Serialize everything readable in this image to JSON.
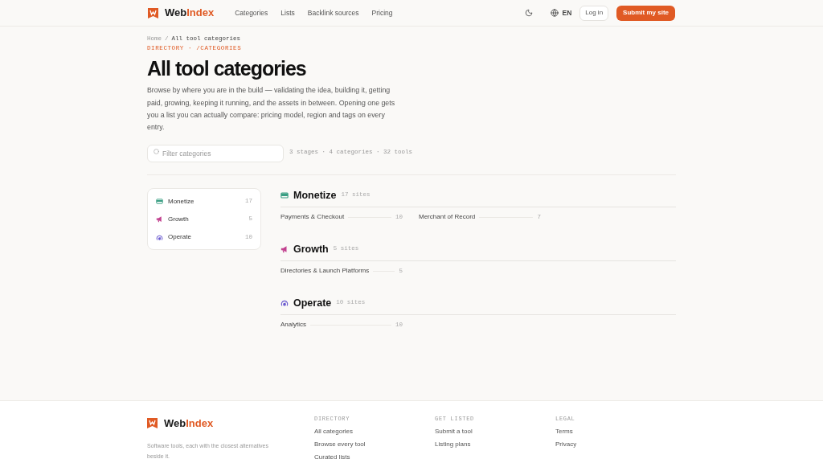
{
  "header": {
    "logo": {
      "first": "Web",
      "second": "Index"
    },
    "nav": [
      {
        "label": "Categories"
      },
      {
        "label": "Lists"
      },
      {
        "label": "Backlink sources"
      },
      {
        "label": "Pricing"
      }
    ],
    "language": "EN",
    "login": "Log in",
    "submit": "Submit my site"
  },
  "breadcrumb": {
    "home": "Home",
    "separator": "/",
    "current": "All tool categories"
  },
  "eyebrow": "DIRECTORY · /CATEGORIES",
  "title": "All tool categories",
  "intro": "Browse by where you are in the build — validating the idea, building it, getting paid, growing, keeping it running, and the assets in between. Opening one gets you a list you can actually compare: pricing model, region and tags on every entry.",
  "filter": {
    "placeholder": "Filter categories",
    "stats": "3 stages · 4 categories · 32 tools"
  },
  "sidebar": [
    {
      "label": "Monetize",
      "count": "17",
      "kind": "card",
      "color": "#3a9e83"
    },
    {
      "label": "Growth",
      "count": "5",
      "kind": "megaphone",
      "color": "#c2418f"
    },
    {
      "label": "Operate",
      "count": "10",
      "kind": "gauge",
      "color": "#6b5bd0"
    }
  ],
  "stages": [
    {
      "title": "Monetize",
      "count": "17 sites",
      "kind": "card",
      "color": "#3a9e83",
      "categories": [
        {
          "name": "Payments & Checkout",
          "count": "10"
        },
        {
          "name": "Merchant of Record",
          "count": "7"
        }
      ]
    },
    {
      "title": "Growth",
      "count": "5 sites",
      "kind": "megaphone",
      "color": "#c2418f",
      "categories": [
        {
          "name": "Directories & Launch Platforms",
          "count": "5"
        }
      ]
    },
    {
      "title": "Operate",
      "count": "10 sites",
      "kind": "gauge",
      "color": "#6b5bd0",
      "categories": [
        {
          "name": "Analytics",
          "count": "10"
        }
      ]
    }
  ],
  "footer": {
    "logo": {
      "first": "Web",
      "second": "Index"
    },
    "tagline": "Software tools, each with the closest alternatives beside it.",
    "columns": [
      {
        "heading": "DIRECTORY",
        "links": [
          "All categories",
          "Browse every tool",
          "Curated lists"
        ]
      },
      {
        "heading": "GET LISTED",
        "links": [
          "Submit a tool",
          "Listing plans"
        ]
      },
      {
        "heading": "LEGAL",
        "links": [
          "Terms",
          "Privacy"
        ]
      }
    ]
  }
}
